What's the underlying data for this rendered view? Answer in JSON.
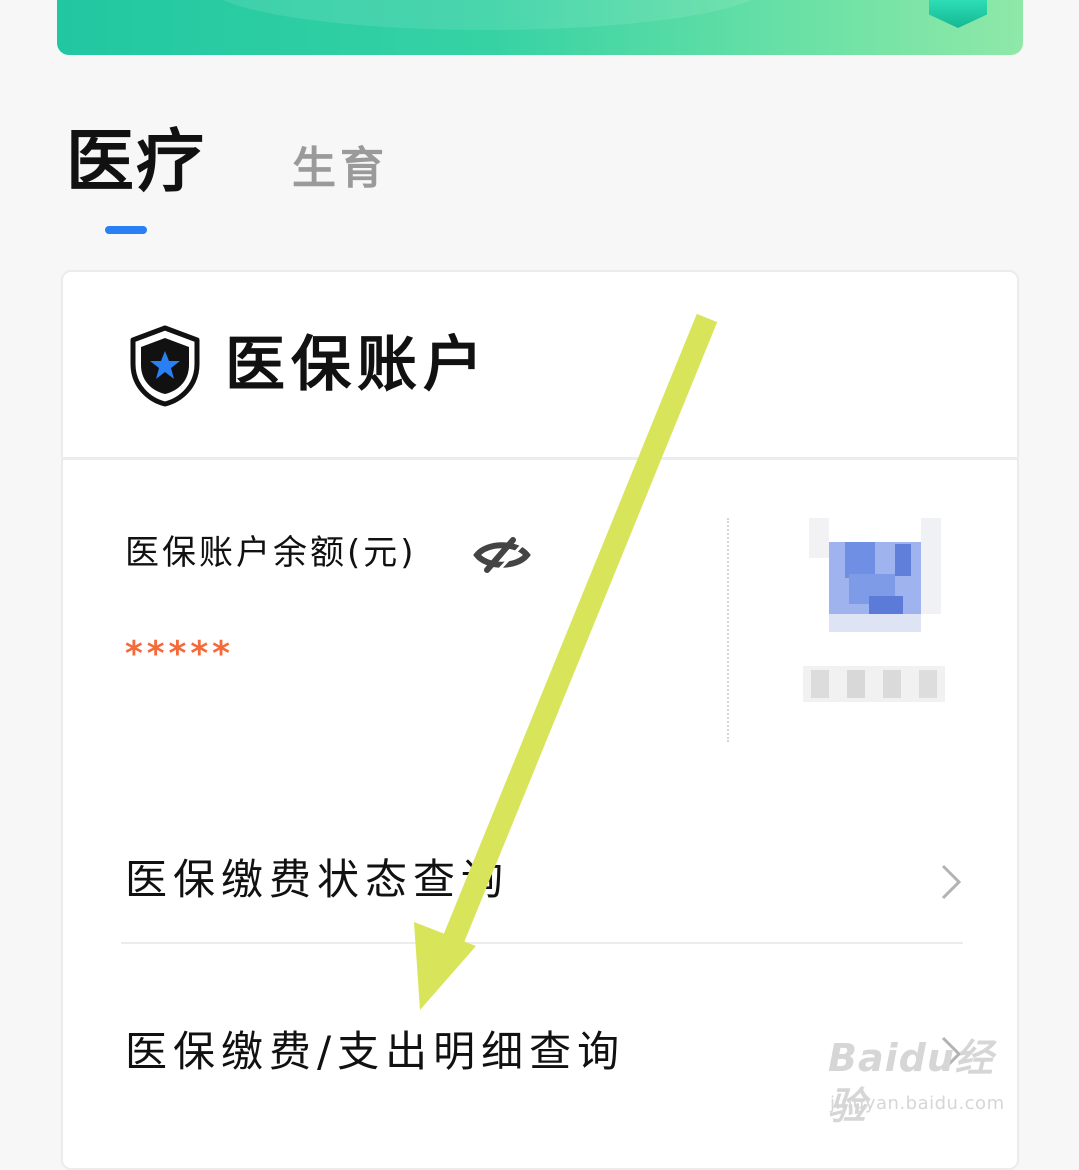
{
  "tabs": [
    {
      "label": "医疗",
      "active": true
    },
    {
      "label": "生育",
      "active": false
    }
  ],
  "account_card": {
    "title": "医保账户",
    "icon": "shield-star-icon",
    "balance_label": "医保账户余额(元)",
    "balance_value": "*****",
    "visibility_icon": "eye-hidden-icon"
  },
  "menu": [
    {
      "label": "医保缴费状态查询",
      "icon": "chevron-right-icon"
    },
    {
      "label": "医保缴费/支出明细查询",
      "icon": "chevron-right-icon"
    }
  ],
  "watermark": {
    "logo": "Baidu经验",
    "url": "jingyan.baidu.com"
  },
  "colors": {
    "banner_start": "#21c7a1",
    "banner_end": "#8fe8a8",
    "tab_indicator": "#2a7ff5",
    "balance_masked": "#f46a3a",
    "annotation_arrow": "#d8e459"
  }
}
